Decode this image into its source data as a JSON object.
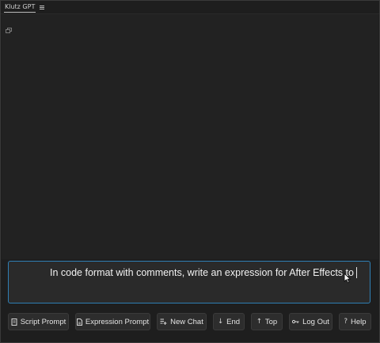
{
  "panel": {
    "tab_label": "Klutz GPT",
    "tab_menu_icon": "hamburger-menu-icon"
  },
  "content": {
    "corner_icon": "expand-icon"
  },
  "prompt": {
    "value": "In code format with comments, write an expression for After Effects to",
    "accent_color": "#2f7fb4"
  },
  "toolbar": {
    "script_prompt": {
      "label": "Script Prompt",
      "icon": "script-icon"
    },
    "expression_prompt": {
      "label": "Expression Prompt",
      "icon": "document-icon"
    },
    "new_chat": {
      "label": "New Chat",
      "icon": "new-chat-icon"
    },
    "end": {
      "label": "End",
      "icon": "arrow-down-icon"
    },
    "top": {
      "label": "Top",
      "icon": "arrow-up-icon"
    },
    "log_out": {
      "label": "Log Out",
      "icon": "key-icon"
    },
    "help": {
      "label": "Help",
      "icon": "question-icon"
    }
  }
}
